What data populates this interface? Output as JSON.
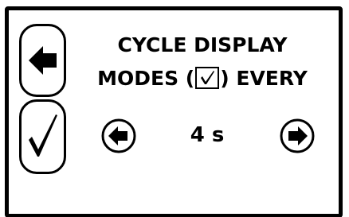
{
  "screen": {
    "title_line1": "CYCLE DISPLAY",
    "title_line2_prefix": "MODES (",
    "title_line2_suffix": ") EVERY",
    "interval_value": "4 s"
  },
  "icons": {
    "back": "left-arrow-icon",
    "confirm": "checkmark-icon",
    "checkbox": "checked-box-icon",
    "prev": "circle-left-arrow-icon",
    "next": "circle-right-arrow-icon"
  },
  "colors": {
    "foreground": "#000000",
    "background": "#ffffff"
  }
}
